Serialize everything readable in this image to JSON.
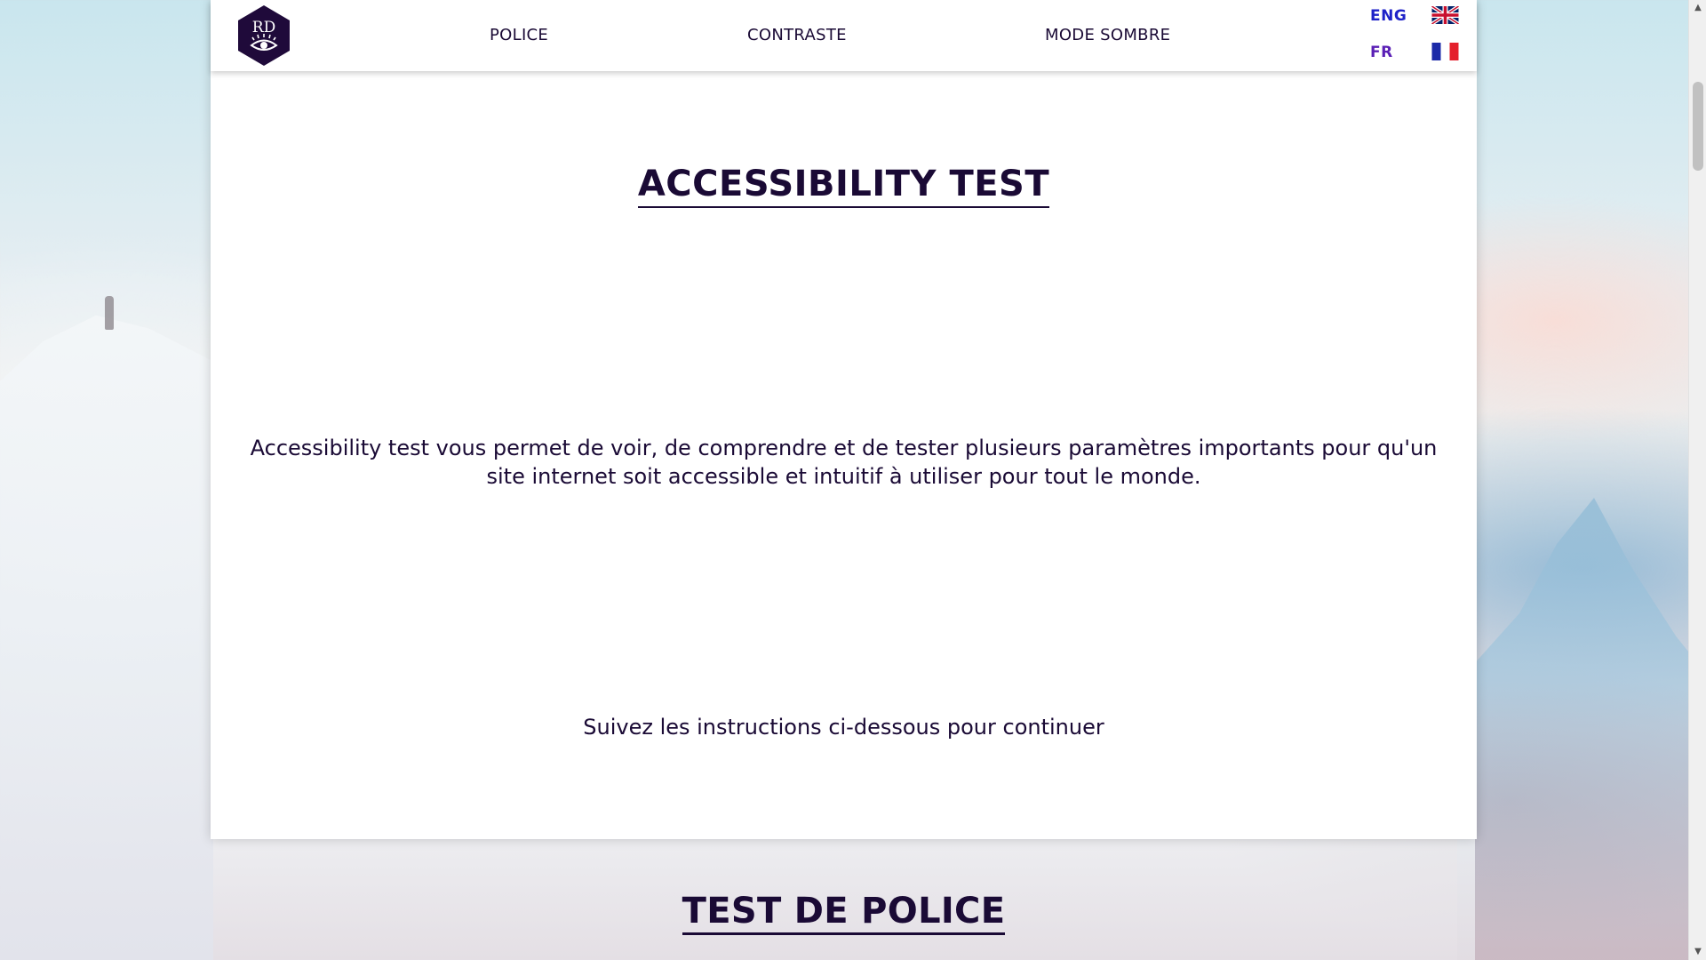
{
  "logo": {
    "text": "RD",
    "icon": "eye-icon",
    "color": "#1f0a3a"
  },
  "nav": {
    "items": [
      {
        "label": "POLICE"
      },
      {
        "label": "CONTRASTE"
      },
      {
        "label": "MODE SOMBRE"
      }
    ]
  },
  "languages": [
    {
      "label": "ENG",
      "flag": "uk-flag-icon",
      "color": "#1e22c8"
    },
    {
      "label": "FR",
      "flag": "france-flag-icon",
      "color": "#5a1fb5"
    }
  ],
  "main": {
    "title": "ACCESSIBILITY TEST",
    "intro_line1": "Accessibility test vous permet de voir, de comprendre et de tester plusieurs paramètres importants pour qu'un",
    "intro_line2": "site internet soit accessible et intuitif à utiliser pour tout le monde.",
    "instructions": "Suivez les instructions ci-dessous pour continuer"
  },
  "next_section": {
    "title": "TEST DE POLICE"
  },
  "colors": {
    "text": "#1a0a35",
    "card": "#ffffff"
  }
}
